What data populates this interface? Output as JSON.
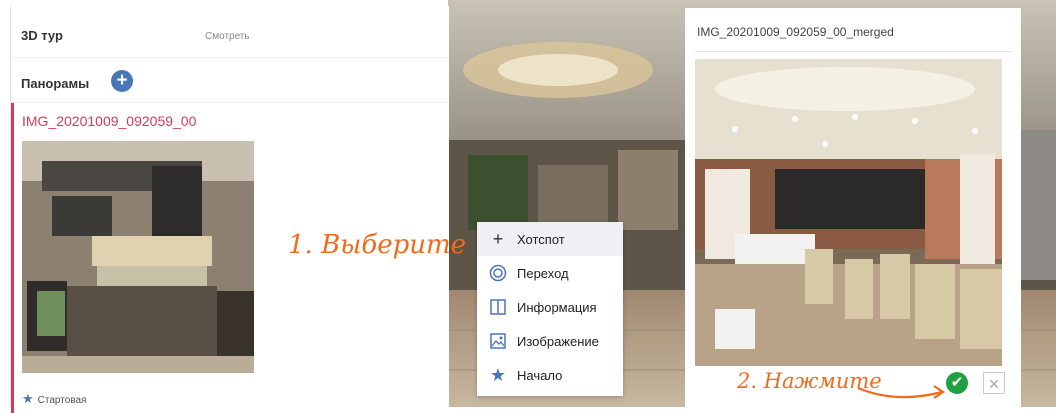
{
  "sidebar": {
    "tour_title": "3D тур",
    "view_link": "Смотреть",
    "panoramas_title": "Панорамы",
    "add_icon": "plus-circle-icon",
    "item": {
      "name": "IMG_20201009_092059_00",
      "start_label": "Стартовая",
      "start_icon": "star-icon"
    }
  },
  "context_menu": {
    "items": [
      {
        "label": "Хотспот",
        "icon": "plus-icon"
      },
      {
        "label": "Переход",
        "icon": "target-icon"
      },
      {
        "label": "Информация",
        "icon": "info-icon"
      },
      {
        "label": "Изображение",
        "icon": "image-icon"
      },
      {
        "label": "Начало",
        "icon": "star-icon"
      }
    ]
  },
  "preview": {
    "title": "IMG_20201009_092059_00_merged",
    "confirm_icon": "check-icon",
    "close_icon": "close-icon"
  },
  "annotations": {
    "step1": "1. Выберите",
    "step2": "2. Нажмите"
  },
  "colors": {
    "accent_blue": "#4a76b8",
    "active_red": "#d8385a",
    "annotation_orange": "#f26b1d",
    "confirm_green": "#21a041"
  }
}
